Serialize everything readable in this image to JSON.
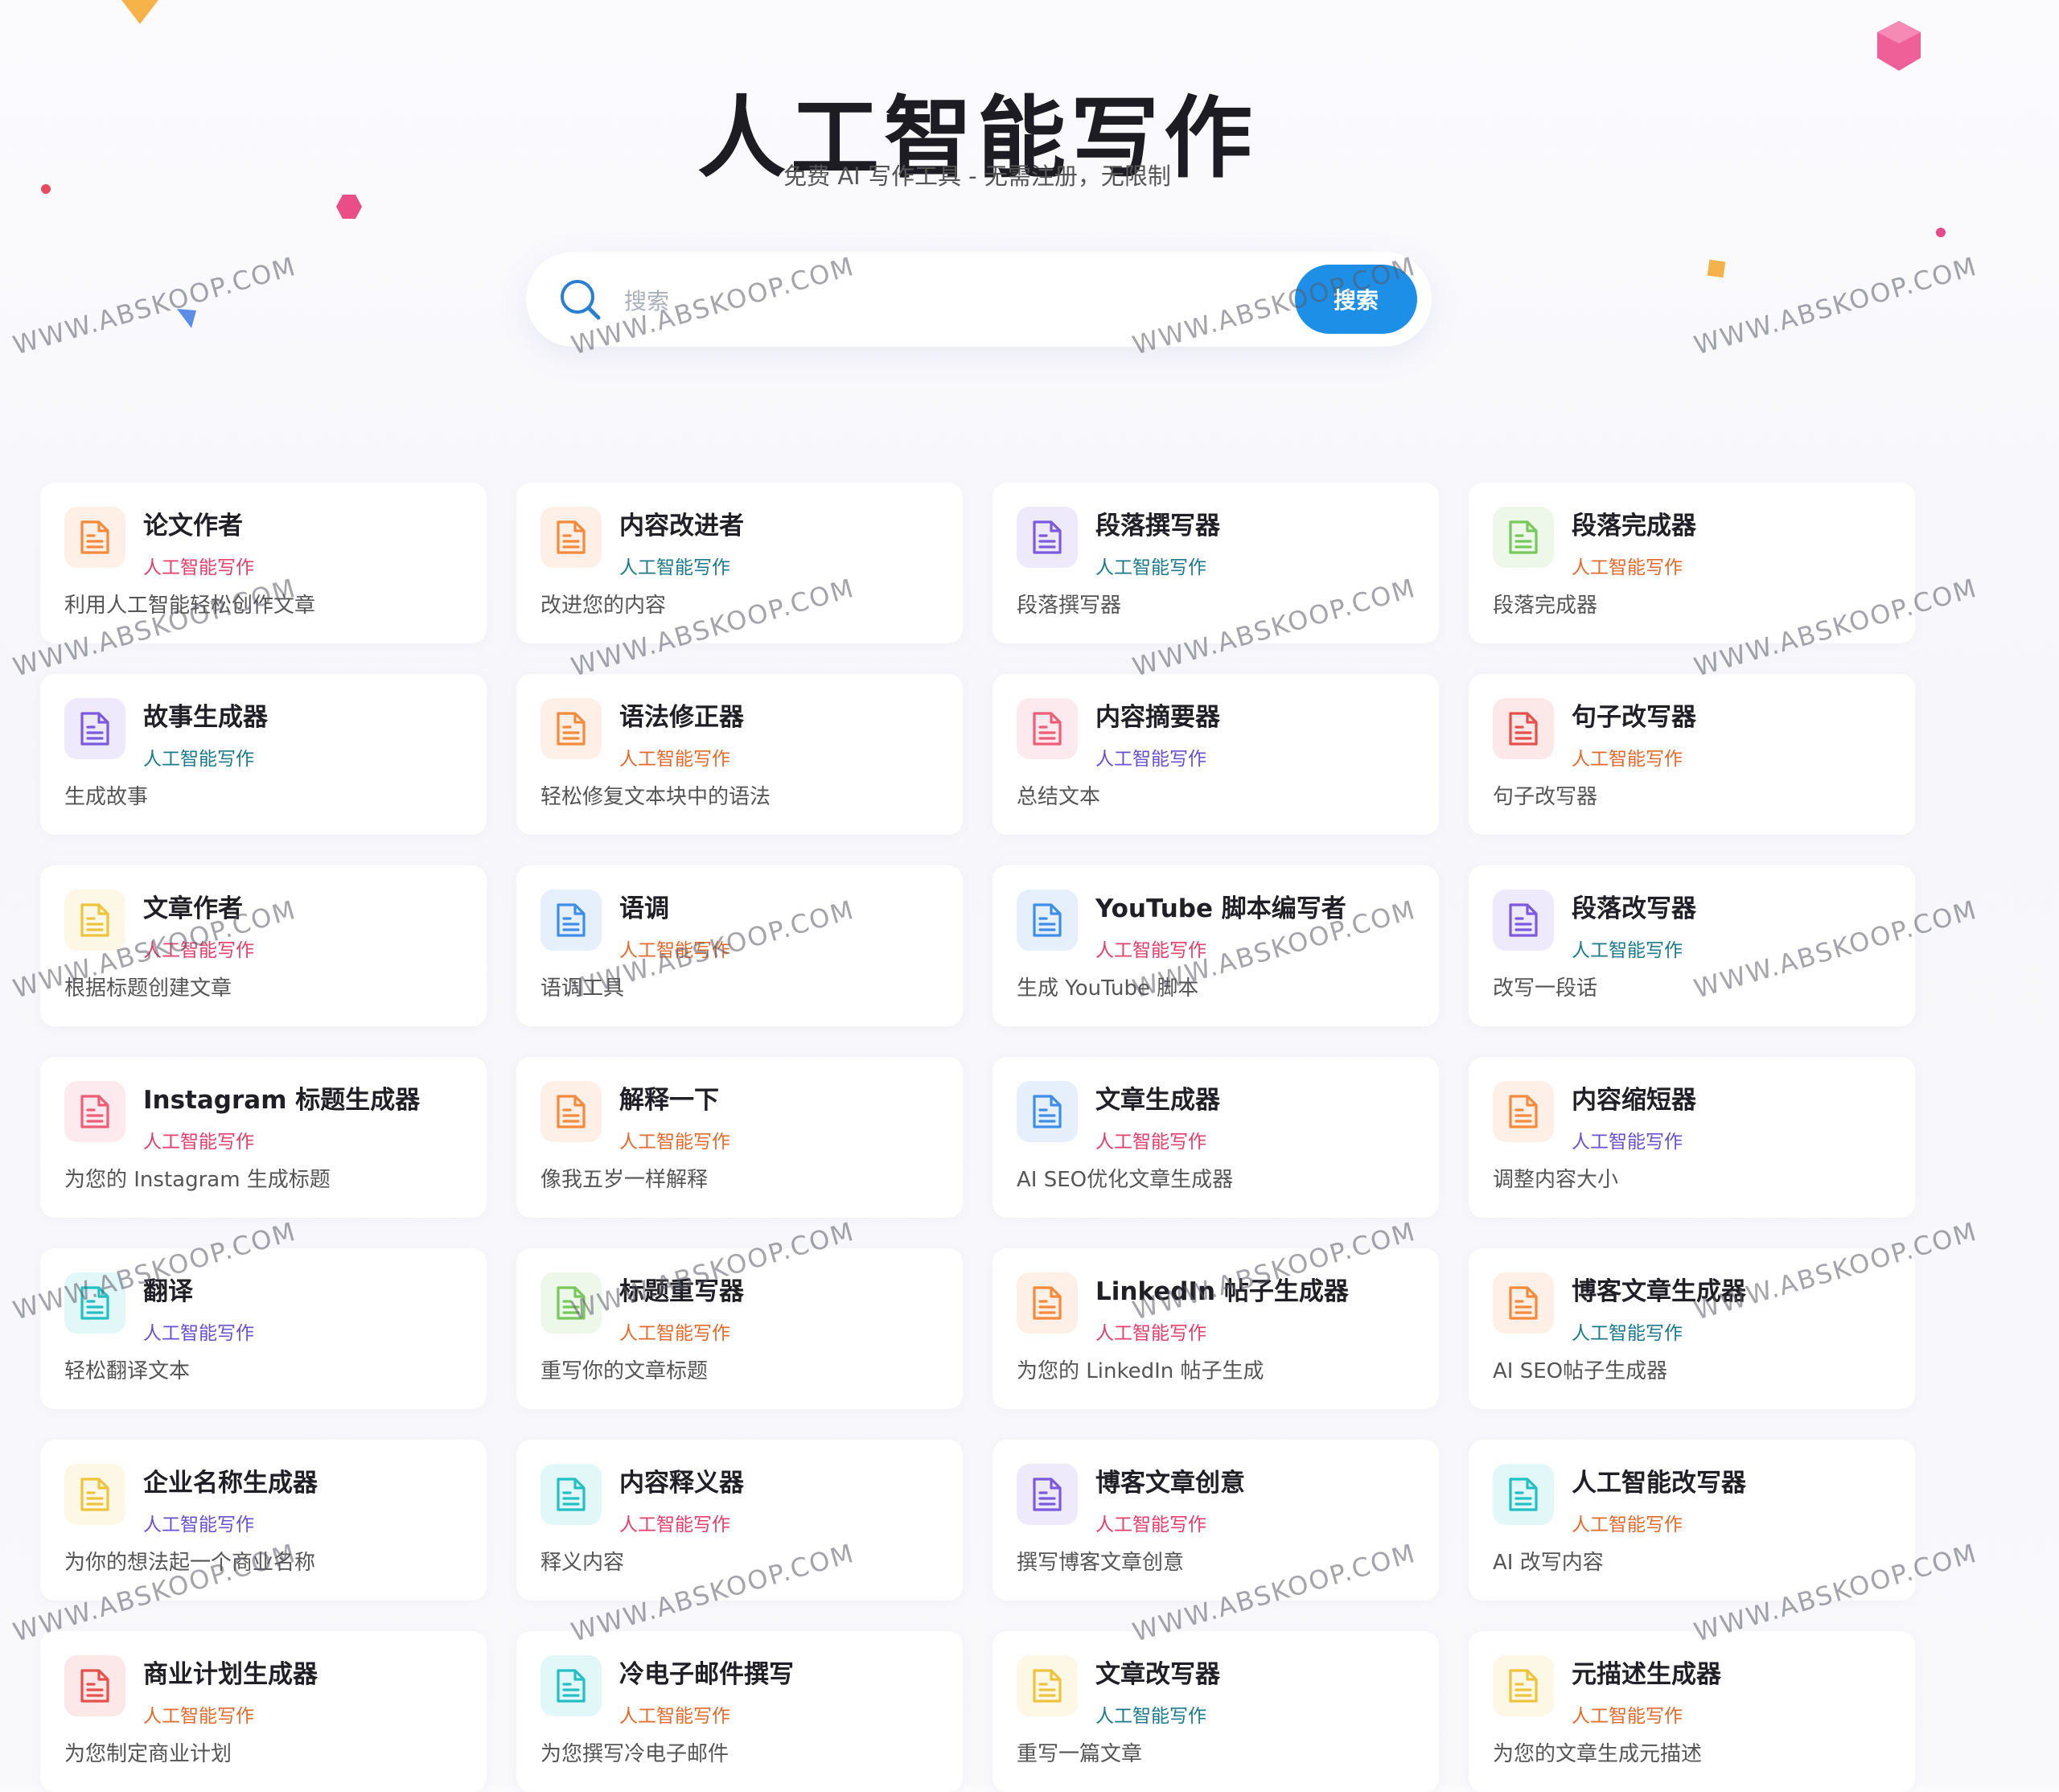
{
  "header": {
    "title": "人工智能写作",
    "subtitle": "免费 AI 写作工具 - 无需注册，无限制"
  },
  "search": {
    "placeholder": "搜索",
    "button_label": "搜索"
  },
  "watermark_text": "WWW.ABSKOOP.COM",
  "colors": {
    "orange": "#f48a3c",
    "purple": "#7a5be0",
    "green": "#76c95a",
    "red": "#e6504a",
    "pink": "#ee5e78",
    "yellow": "#eec43c",
    "blue": "#3e8ee8",
    "teal": "#22c0c4",
    "button": "#1e8fe6"
  },
  "tools": [
    {
      "title": "论文作者",
      "category": "人工智能写作",
      "desc": "利用人工智能轻松创作文章",
      "icon": "document-icon",
      "icon_color": "orange",
      "cat_color": "#e63e6a"
    },
    {
      "title": "内容改进者",
      "category": "人工智能写作",
      "desc": "改进您的内容",
      "icon": "document-icon",
      "icon_color": "orange",
      "cat_color": "#1b7a8a"
    },
    {
      "title": "段落撰写器",
      "category": "人工智能写作",
      "desc": "段落撰写器",
      "icon": "document-icon",
      "icon_color": "purple",
      "cat_color": "#1b7a8a"
    },
    {
      "title": "段落完成器",
      "category": "人工智能写作",
      "desc": "段落完成器",
      "icon": "document-icon",
      "icon_color": "green",
      "cat_color": "#e46a2c"
    },
    {
      "title": "故事生成器",
      "category": "人工智能写作",
      "desc": "生成故事",
      "icon": "document-icon",
      "icon_color": "purple",
      "cat_color": "#1b7a8a"
    },
    {
      "title": "语法修正器",
      "category": "人工智能写作",
      "desc": "轻松修复文本块中的语法",
      "icon": "document-icon",
      "icon_color": "orange",
      "cat_color": "#e46a2c"
    },
    {
      "title": "内容摘要器",
      "category": "人工智能写作",
      "desc": "总结文本",
      "icon": "document-icon",
      "icon_color": "pink",
      "cat_color": "#6a4fd0"
    },
    {
      "title": "句子改写器",
      "category": "人工智能写作",
      "desc": "句子改写器",
      "icon": "document-icon",
      "icon_color": "red",
      "cat_color": "#e46a2c"
    },
    {
      "title": "文章作者",
      "category": "人工智能写作",
      "desc": "根据标题创建文章",
      "icon": "document-icon",
      "icon_color": "yellow",
      "cat_color": "#e63e6a"
    },
    {
      "title": "语调",
      "category": "人工智能写作",
      "desc": "语调工具",
      "icon": "document-icon",
      "icon_color": "blue",
      "cat_color": "#e46a2c"
    },
    {
      "title": "YouTube 脚本编写者",
      "category": "人工智能写作",
      "desc": "生成 YouTube 脚本",
      "icon": "document-icon",
      "icon_color": "blue",
      "cat_color": "#e63e6a"
    },
    {
      "title": "段落改写器",
      "category": "人工智能写作",
      "desc": "改写一段话",
      "icon": "document-icon",
      "icon_color": "purple",
      "cat_color": "#1b7a8a"
    },
    {
      "title": "Instagram 标题生成器",
      "category": "人工智能写作",
      "desc": "为您的 Instagram 生成标题",
      "icon": "document-icon",
      "icon_color": "pink",
      "cat_color": "#e63e6a"
    },
    {
      "title": "解释一下",
      "category": "人工智能写作",
      "desc": "像我五岁一样解释",
      "icon": "document-icon",
      "icon_color": "orange",
      "cat_color": "#e46a2c"
    },
    {
      "title": "文章生成器",
      "category": "人工智能写作",
      "desc": "AI SEO优化文章生成器",
      "icon": "document-icon",
      "icon_color": "blue",
      "cat_color": "#e63e6a"
    },
    {
      "title": "内容缩短器",
      "category": "人工智能写作",
      "desc": "调整内容大小",
      "icon": "document-icon",
      "icon_color": "orange",
      "cat_color": "#6a4fd0"
    },
    {
      "title": "翻译",
      "category": "人工智能写作",
      "desc": "轻松翻译文本",
      "icon": "document-icon",
      "icon_color": "teal",
      "cat_color": "#6a4fd0"
    },
    {
      "title": "标题重写器",
      "category": "人工智能写作",
      "desc": "重写你的文章标题",
      "icon": "document-icon",
      "icon_color": "green",
      "cat_color": "#e46a2c"
    },
    {
      "title": "LinkedIn 帖子生成器",
      "category": "人工智能写作",
      "desc": "为您的 LinkedIn 帖子生成",
      "icon": "document-icon",
      "icon_color": "orange",
      "cat_color": "#e63e6a"
    },
    {
      "title": "博客文章生成器",
      "category": "人工智能写作",
      "desc": "AI SEO帖子生成器",
      "icon": "document-icon",
      "icon_color": "orange",
      "cat_color": "#1b7a8a"
    },
    {
      "title": "企业名称生成器",
      "category": "人工智能写作",
      "desc": "为你的想法起一个商业名称",
      "icon": "document-icon",
      "icon_color": "yellow",
      "cat_color": "#6a4fd0"
    },
    {
      "title": "内容释义器",
      "category": "人工智能写作",
      "desc": "释义内容",
      "icon": "document-icon",
      "icon_color": "teal",
      "cat_color": "#e63e6a"
    },
    {
      "title": "博客文章创意",
      "category": "人工智能写作",
      "desc": "撰写博客文章创意",
      "icon": "document-icon",
      "icon_color": "purple",
      "cat_color": "#e63e6a"
    },
    {
      "title": "人工智能改写器",
      "category": "人工智能写作",
      "desc": "AI 改写内容",
      "icon": "document-icon",
      "icon_color": "teal",
      "cat_color": "#e46a2c"
    },
    {
      "title": "商业计划生成器",
      "category": "人工智能写作",
      "desc": "为您制定商业计划",
      "icon": "document-icon",
      "icon_color": "red",
      "cat_color": "#e46a2c"
    },
    {
      "title": "冷电子邮件撰写",
      "category": "人工智能写作",
      "desc": "为您撰写冷电子邮件",
      "icon": "document-icon",
      "icon_color": "teal",
      "cat_color": "#e46a2c"
    },
    {
      "title": "文章改写器",
      "category": "人工智能写作",
      "desc": "重写一篇文章",
      "icon": "document-icon",
      "icon_color": "yellow",
      "cat_color": "#1b7a8a"
    },
    {
      "title": "元描述生成器",
      "category": "人工智能写作",
      "desc": "为您的文章生成元描述",
      "icon": "document-icon",
      "icon_color": "yellow",
      "cat_color": "#e46a2c"
    }
  ]
}
